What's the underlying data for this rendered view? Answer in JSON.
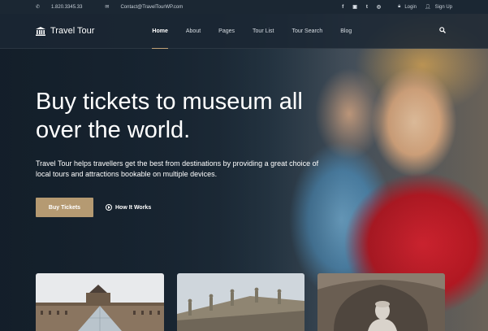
{
  "topbar": {
    "phone": "1.820.3345.33",
    "email": "Contact@TravelTourWP.com",
    "social": [
      "f",
      "▣",
      "t",
      "◎"
    ],
    "login": "Login",
    "signup": "Sign Up"
  },
  "nav": {
    "logo": "Travel Tour",
    "items": [
      {
        "label": "Home"
      },
      {
        "label": "About"
      },
      {
        "label": "Pages"
      },
      {
        "label": "Tour List"
      },
      {
        "label": "Tour Search"
      },
      {
        "label": "Blog"
      }
    ],
    "active_index": 0
  },
  "hero": {
    "title": "Buy tickets to museum all over the world.",
    "description": "Travel Tour helps travellers get the best from destinations by providing a great choice of local tours and attractions bookable on multiple devices.",
    "buy_button": "Buy Tickets",
    "how_button": "How It Works"
  },
  "icons": {
    "phone": "phone-icon",
    "email": "mail-icon",
    "login": "lock-icon",
    "signup": "user-icon",
    "search": "search-icon",
    "logo": "museum-building-icon",
    "play": "play-circle-icon"
  },
  "colors": {
    "accent": "#b59a72",
    "topbar": "#1b2733",
    "nav": "#1b2733"
  }
}
